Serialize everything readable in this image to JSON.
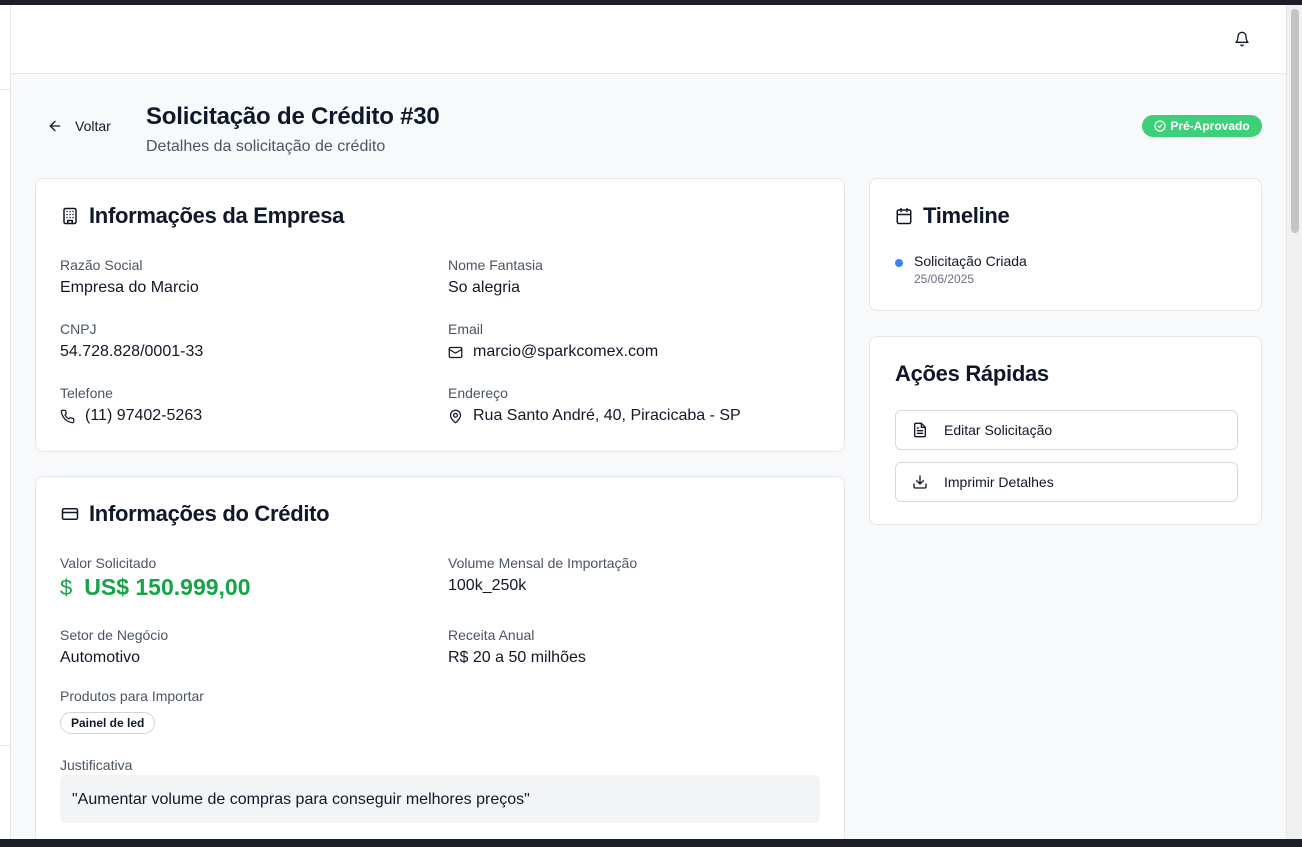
{
  "header": {
    "back_label": "Voltar",
    "title": "Solicitação de Crédito #30",
    "subtitle": "Detalhes da solicitação de crédito",
    "status_badge": "Pré-Aprovado"
  },
  "company_card": {
    "title": "Informações da Empresa",
    "fields": {
      "razao_social": {
        "label": "Razão Social",
        "value": "Empresa do Marcio"
      },
      "nome_fantasia": {
        "label": "Nome Fantasia",
        "value": "So alegria"
      },
      "cnpj": {
        "label": "CNPJ",
        "value": "54.728.828/0001-33"
      },
      "email": {
        "label": "Email",
        "value": "marcio@sparkcomex.com"
      },
      "telefone": {
        "label": "Telefone",
        "value": "(11) 97402-5263"
      },
      "endereco": {
        "label": "Endereço",
        "value": "Rua Santo André, 40, Piracicaba - SP"
      }
    }
  },
  "credit_card": {
    "title": "Informações do Crédito",
    "fields": {
      "valor_solicitado": {
        "label": "Valor Solicitado",
        "value": "US$ 150.999,00",
        "symbol": "$"
      },
      "volume_mensal": {
        "label": "Volume Mensal de Importação",
        "value": "100k_250k"
      },
      "setor": {
        "label": "Setor de Negócio",
        "value": "Automotivo"
      },
      "receita": {
        "label": "Receita Anual",
        "value": "R$ 20 a 50 milhões"
      },
      "produtos": {
        "label": "Produtos para Importar",
        "items": [
          "Painel de led"
        ]
      },
      "justificativa": {
        "label": "Justificativa",
        "value": "\"Aumentar volume de compras para conseguir melhores preços\""
      }
    }
  },
  "timeline": {
    "title": "Timeline",
    "events": [
      {
        "label": "Solicitação Criada",
        "date": "25/06/2025"
      }
    ]
  },
  "quick_actions": {
    "title": "Ações Rápidas",
    "buttons": [
      {
        "label": "Editar Solicitação",
        "icon": "file-text-icon"
      },
      {
        "label": "Imprimir Detalhes",
        "icon": "download-icon"
      }
    ]
  },
  "colors": {
    "accent_green": "#16a34a",
    "badge_green": "#3ecf7a",
    "timeline_blue": "#3b82f6"
  }
}
